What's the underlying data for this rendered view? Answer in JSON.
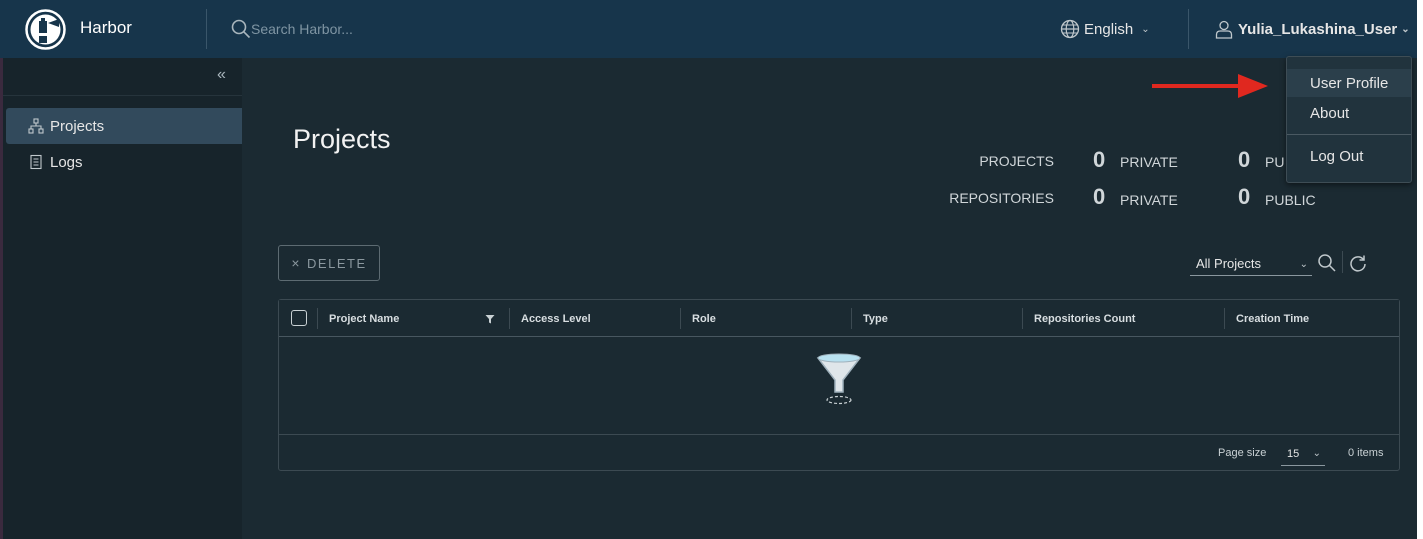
{
  "header": {
    "brand": "Harbor",
    "search_placeholder": "Search Harbor...",
    "language": "English",
    "user": "Yulia_Lukashina_User"
  },
  "sidebar": {
    "items": [
      {
        "label": "Projects",
        "icon": "projects-icon",
        "active": true
      },
      {
        "label": "Logs",
        "icon": "logs-icon",
        "active": false
      }
    ]
  },
  "main": {
    "title": "Projects",
    "stats": {
      "projects_label": "PROJECTS",
      "repositories_label": "REPOSITORIES",
      "projects_private": "0",
      "projects_public": "0",
      "repositories_private": "0",
      "repositories_public": "0",
      "private_label": "PRIVATE",
      "public_label_cut": "PU",
      "public_label": "PUBLIC"
    },
    "toolbar": {
      "delete_label": "DELETE",
      "filter_selected": "All Projects"
    },
    "table": {
      "columns": [
        "Project Name",
        "Access Level",
        "Role",
        "Type",
        "Repositories Count",
        "Creation Time"
      ],
      "page_size_label": "Page size",
      "page_size": "15",
      "items_label": "0 items"
    }
  },
  "user_menu": {
    "items": [
      "User Profile",
      "About",
      "Log Out"
    ]
  },
  "colors": {
    "header_bg": "#17354b",
    "sidebar_bg": "#17242b",
    "main_bg": "#1b2a32",
    "active_nav": "#324a5c",
    "annotation_arrow": "#e0281f"
  }
}
